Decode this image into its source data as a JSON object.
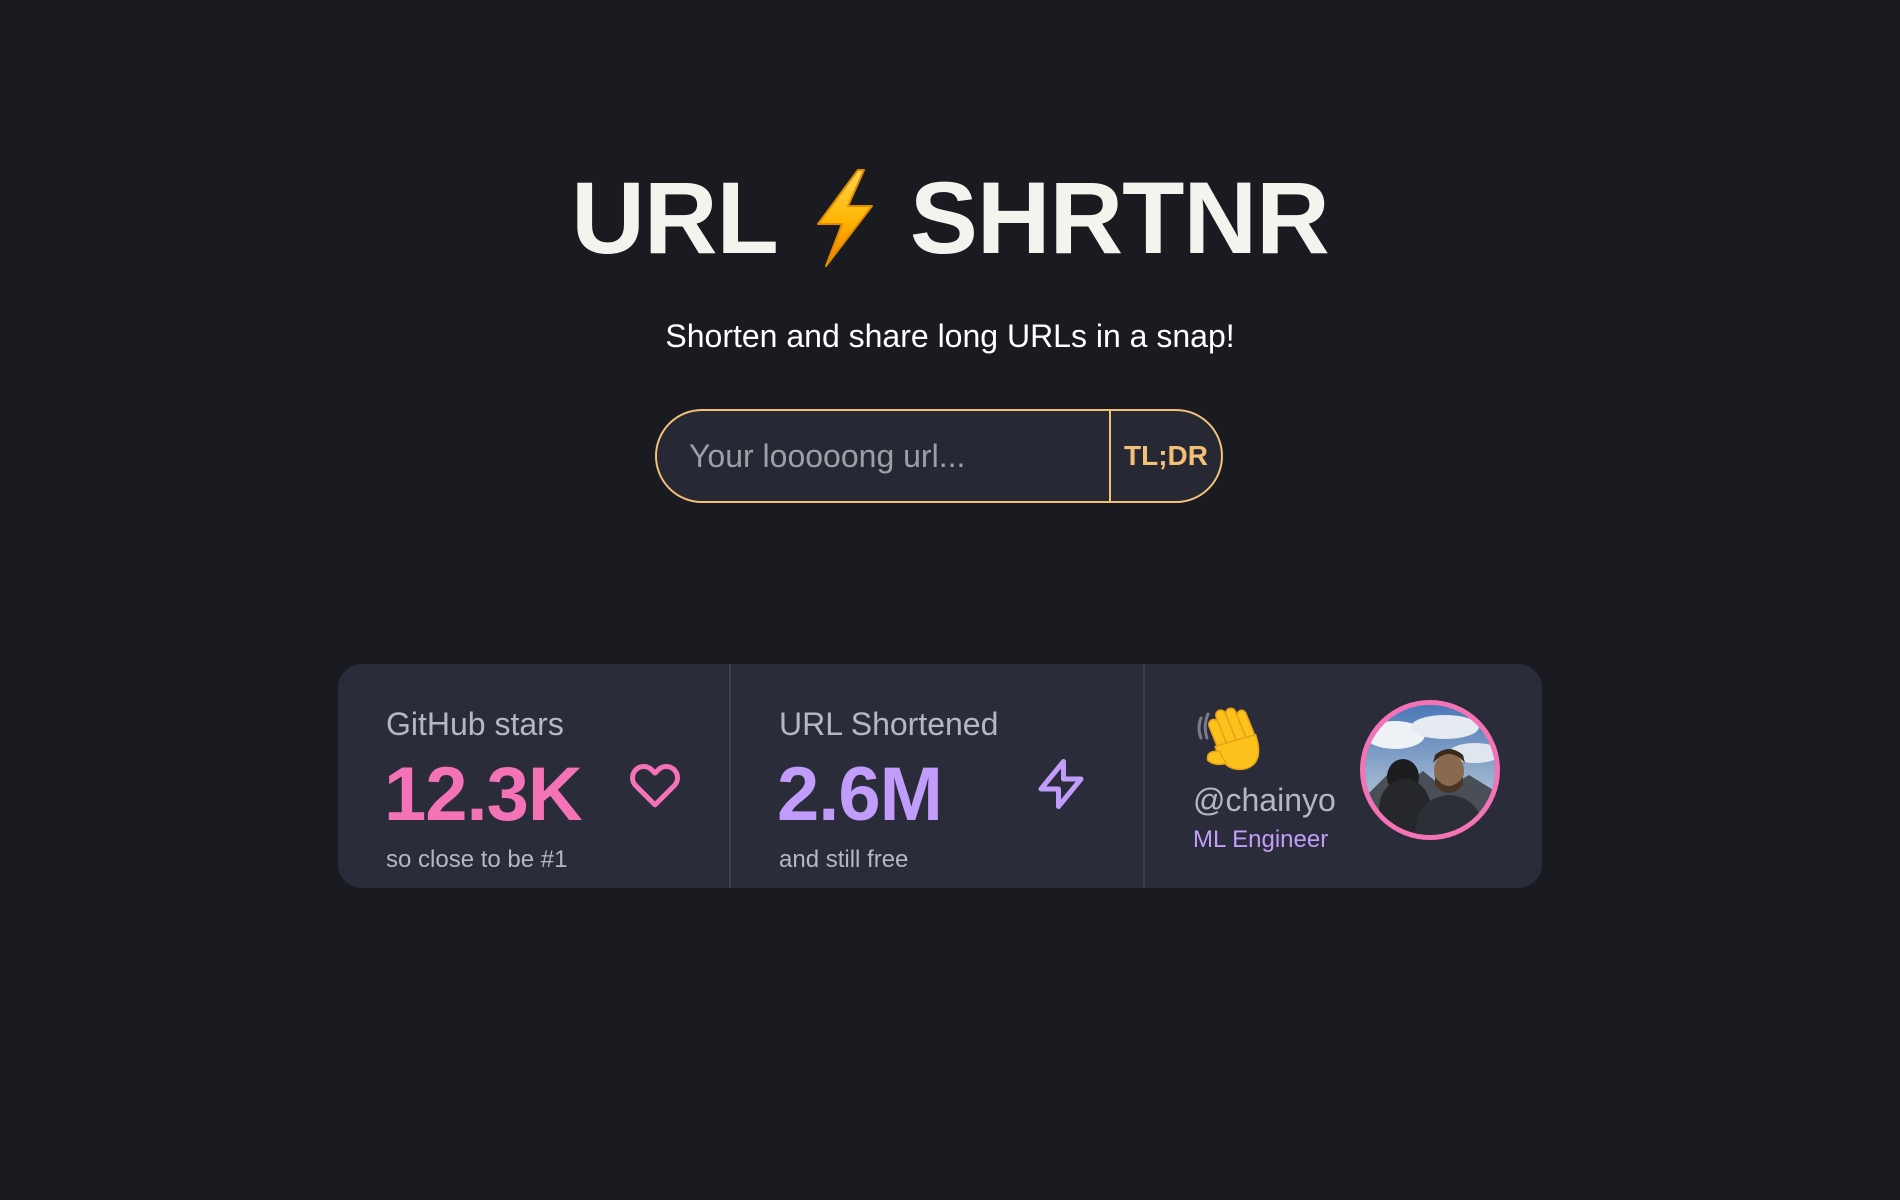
{
  "hero": {
    "title_left": "URL",
    "title_icon": "lightning-bolt-icon",
    "title_right": "SHRTNR",
    "subtitle": "Shorten and share long URLs in a snap!"
  },
  "shortener": {
    "placeholder": "Your looooong url...",
    "value": "",
    "button_label": "TL;DR"
  },
  "stats": [
    {
      "title": "GitHub stars",
      "value": "12.3K",
      "description": "so close to be #1",
      "icon": "heart-icon",
      "color": "#f472b6"
    },
    {
      "title": "URL Shortened",
      "value": "2.6M",
      "description": "and still free",
      "icon": "lightning-icon",
      "color": "#c29cfa"
    }
  ],
  "user": {
    "emoji": "waving-hand-icon",
    "handle": "@chainyo",
    "role": "ML Engineer",
    "avatar_border_color": "#f472b6"
  },
  "colors": {
    "background": "#1a1b21",
    "card": "#2a2c39",
    "accent": "#f3c078",
    "pink": "#f472b6",
    "purple": "#c29cfa"
  }
}
